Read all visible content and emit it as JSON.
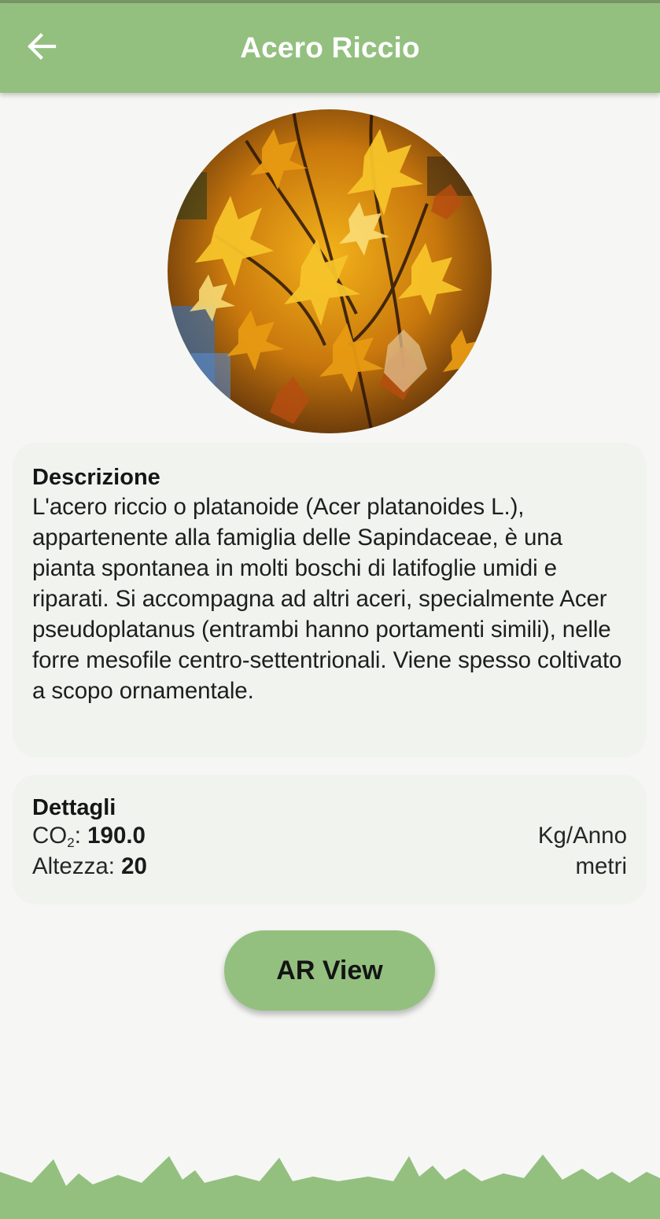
{
  "appbar": {
    "title": "Acero Riccio"
  },
  "photo": {
    "description_icon": "maple-leaves-photo"
  },
  "description_card": {
    "heading": "Descrizione",
    "text": "L'acero riccio o platanoide (Acer platanoides L.), appartenente alla famiglia delle Sapindaceae, è una pianta spontanea in molti boschi di latifoglie umidi e riparati. Si accompagna ad altri aceri, specialmente Acer pseudoplatanus (entrambi hanno portamenti simili), nelle forre mesofile centro-settentrionali. Viene spesso coltivato a scopo ornamentale."
  },
  "details_card": {
    "heading": "Dettagli",
    "co2": {
      "label_main": "CO",
      "label_sub": "2",
      "label_suffix": ":",
      "value": "190.0",
      "unit": "Kg/Anno"
    },
    "height": {
      "label": "Altezza:",
      "value": "20",
      "unit": "metri"
    }
  },
  "ar_button": {
    "label": "AR View"
  },
  "colors": {
    "accent": "#93c07f",
    "background": "#f6f7f4",
    "card": "#f1f3ef"
  }
}
